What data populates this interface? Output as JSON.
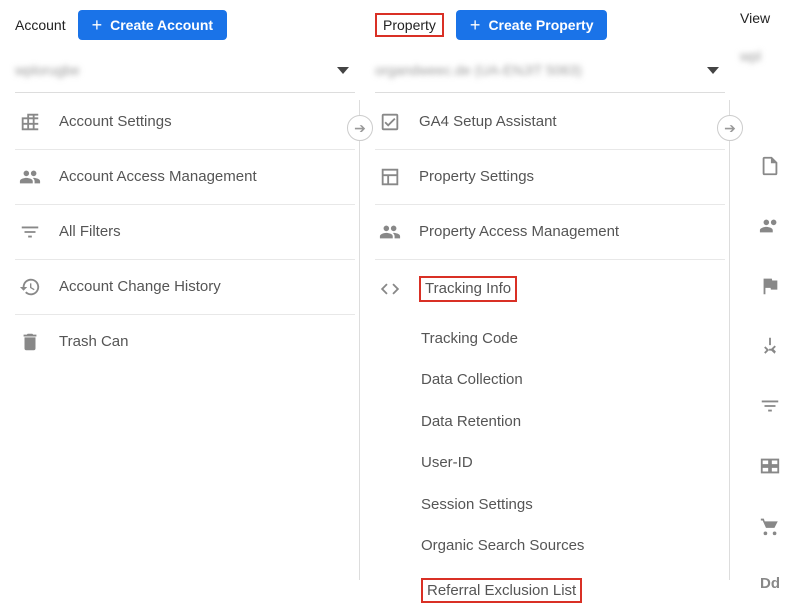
{
  "account": {
    "header_label": "Account",
    "create_button": "Create Account",
    "selector_text": "wplorugbe",
    "items": [
      {
        "label": "Account Settings",
        "icon": "building"
      },
      {
        "label": "Account Access Management",
        "icon": "people"
      },
      {
        "label": "All Filters",
        "icon": "filter"
      },
      {
        "label": "Account Change History",
        "icon": "history"
      },
      {
        "label": "Trash Can",
        "icon": "trash"
      }
    ]
  },
  "property": {
    "header_label": "Property",
    "create_button": "Create Property",
    "selector_text": "organdweec.de (UA-ENJIT 5063)",
    "items": [
      {
        "label": "GA4 Setup Assistant",
        "icon": "checkbox"
      },
      {
        "label": "Property Settings",
        "icon": "layout"
      },
      {
        "label": "Property Access Management",
        "icon": "people"
      },
      {
        "label": "Tracking Info",
        "icon": "code",
        "highlight": true
      }
    ],
    "tracking_sub": [
      "Tracking Code",
      "Data Collection",
      "Data Retention",
      "User-ID",
      "Session Settings",
      "Organic Search Sources",
      "Referral Exclusion List"
    ]
  },
  "view": {
    "header_label": "View",
    "selector_text": "wpl",
    "icons": [
      "page",
      "people",
      "flag",
      "merge",
      "filter",
      "channels",
      "cart",
      "dd"
    ]
  },
  "colors": {
    "accent": "#1a73e8",
    "highlight": "#d93025"
  }
}
